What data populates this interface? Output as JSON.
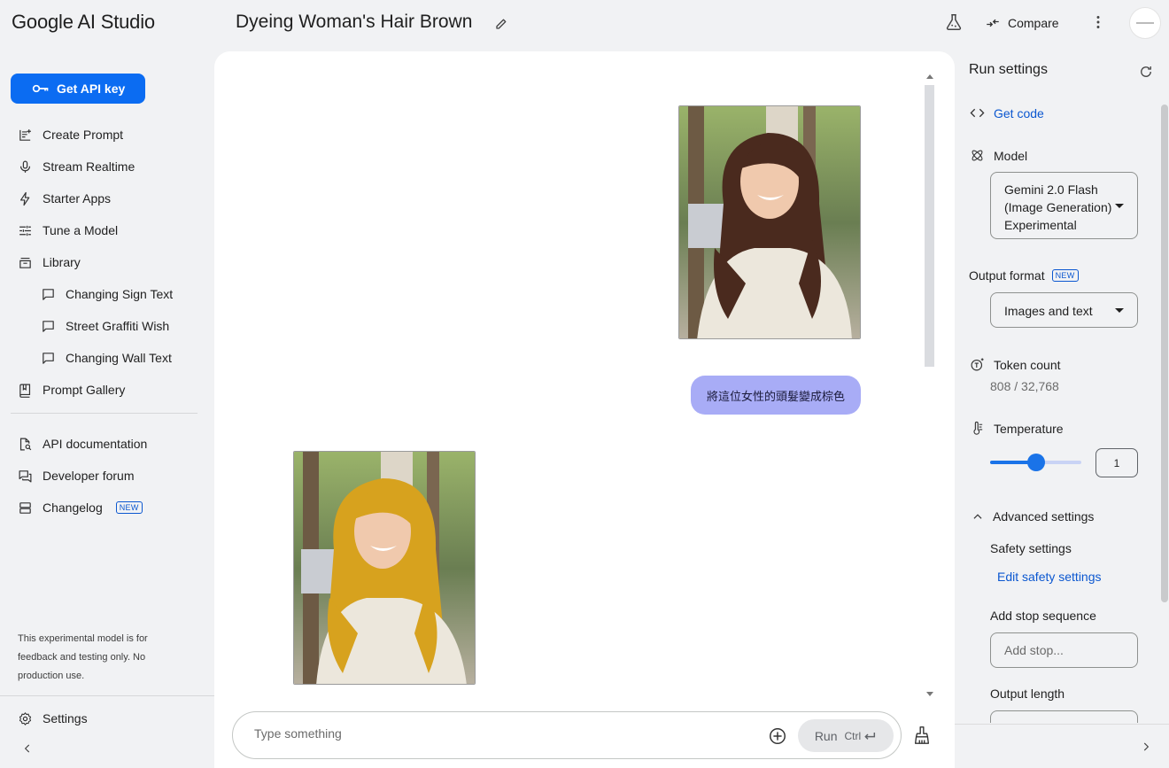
{
  "app": {
    "brand": "Google AI Studio",
    "title": "Dyeing Woman's Hair Brown"
  },
  "header": {
    "compare_label": "Compare"
  },
  "sidebar": {
    "api_key_label": "Get API key",
    "items": [
      {
        "label": "Create Prompt",
        "icon": "create-prompt-icon"
      },
      {
        "label": "Stream Realtime",
        "icon": "microphone-icon"
      },
      {
        "label": "Starter Apps",
        "icon": "bolt-icon"
      },
      {
        "label": "Tune a Model",
        "icon": "tune-icon"
      },
      {
        "label": "Library",
        "icon": "library-icon"
      },
      {
        "label": "Changing Sign Text",
        "icon": "chat-bubble-icon"
      },
      {
        "label": "Street Graffiti Wish",
        "icon": "chat-bubble-icon"
      },
      {
        "label": "Changing Wall Text",
        "icon": "chat-bubble-icon"
      },
      {
        "label": "Prompt Gallery",
        "icon": "book-icon"
      },
      {
        "label": "API documentation",
        "icon": "doc-search-icon"
      },
      {
        "label": "Developer forum",
        "icon": "forum-icon"
      },
      {
        "label": "Changelog",
        "icon": "changelog-icon",
        "badge": "NEW"
      }
    ],
    "disclaimer": "This experimental model is for feedback and testing only. No production use.",
    "settings_label": "Settings"
  },
  "chat": {
    "user_message": "將這位女性的頭髮變成棕色",
    "input_placeholder": "Type something",
    "run_label": "Run",
    "run_shortcut": "Ctrl",
    "images": [
      {
        "description": "woman-dark-brown-hair",
        "hair_color": "#4a2a1e"
      },
      {
        "description": "woman-golden-hair",
        "hair_color": "#d7a21e"
      }
    ]
  },
  "run_settings": {
    "title": "Run settings",
    "get_code_label": "Get code",
    "model_label": "Model",
    "model_value_lines": [
      "Gemini 2.0 Flash",
      "(Image Generation)",
      "Experimental"
    ],
    "output_format_label": "Output format",
    "output_format_badge": "NEW",
    "output_format_value": "Images and text",
    "token_count_label": "Token count",
    "token_count_value": "808 / 32,768",
    "temperature_label": "Temperature",
    "temperature_value": "1",
    "temperature_fraction": 0.5,
    "advanced_label": "Advanced settings",
    "safety_label": "Safety settings",
    "edit_safety_label": "Edit safety settings",
    "stop_sequence_label": "Add stop sequence",
    "stop_placeholder": "Add stop...",
    "output_length_label": "Output length"
  },
  "colors": {
    "accent": "#0b6cf2",
    "link": "#0b57d0",
    "bubble": "#a8acf6",
    "slider": "#1a73e8"
  }
}
